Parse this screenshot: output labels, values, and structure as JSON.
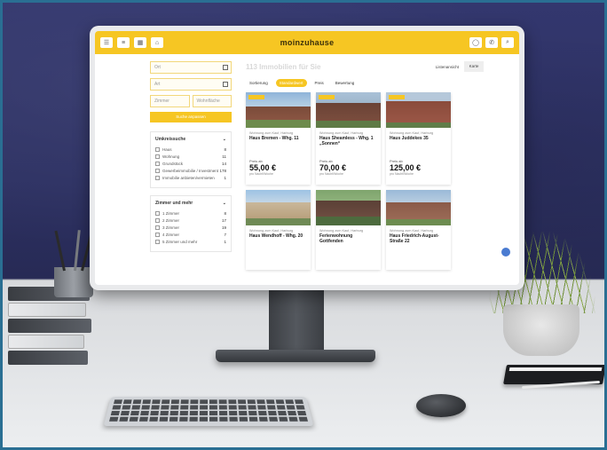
{
  "app": {
    "logo": "moinzuhause",
    "header_left_icons": [
      "menu-icon",
      "list-icon",
      "grid-icon",
      "map-icon"
    ],
    "header_right_icons": [
      "user-icon",
      "phone-icon",
      "search-icon"
    ]
  },
  "search": {
    "fields": [
      "Ort",
      "Art"
    ],
    "zimmer_label": "Zimmer",
    "wohnflaeche_label": "Wohnfläche",
    "submit": "Suche anpassen"
  },
  "filters": [
    {
      "title": "Umkreissuche",
      "options": [
        {
          "label": "Haus",
          "count": "8"
        },
        {
          "label": "Wohnung",
          "count": "11"
        },
        {
          "label": "Grundstück",
          "count": "14"
        },
        {
          "label": "Gewerbeimmobilie / Investment",
          "count": "178"
        },
        {
          "label": "Immobilie anbieten/vermieten",
          "count": "1"
        }
      ]
    },
    {
      "title": "Zimmer und mehr",
      "options": [
        {
          "label": "1 Zimmer",
          "count": "8"
        },
        {
          "label": "2 Zimmer",
          "count": "17"
        },
        {
          "label": "3 Zimmer",
          "count": "19"
        },
        {
          "label": "4 Zimmer",
          "count": "7"
        },
        {
          "label": "5 Zimmer und mehr",
          "count": "1"
        }
      ]
    }
  ],
  "main": {
    "title": "113 Immobilien für Sie",
    "list_label": "Listenansicht",
    "map_button": "Karte",
    "sort_chips": [
      "Sortierung",
      "Standardwert",
      "Preis",
      "Bewertung"
    ],
    "active_chip": 1
  },
  "listings": [
    {
      "meta": "Wohnung zum Kauf, Harburg",
      "name": "Haus Bremen - Whg. 11",
      "pre": "Preis ab",
      "price": "55,00 €",
      "sub": "pro Nacht/Woche"
    },
    {
      "meta": "Wohnung zum Kauf, Harburg",
      "name": "Haus Sheamless - Whg. 1 „Sonnen“",
      "pre": "Preis ab",
      "price": "70,00 €",
      "sub": "pro Nacht/Woche"
    },
    {
      "meta": "Wohnung zum Kauf, Harburg",
      "name": "Haus Juddekes 35",
      "pre": "Preis ab",
      "price": "125,00 €",
      "sub": "pro Nacht/Woche"
    },
    {
      "meta": "Wohnung zum Kauf, Harburg",
      "name": "Haus Wendhoff - Whg. 20",
      "pre": "",
      "price": "",
      "sub": ""
    },
    {
      "meta": "Wohnung zum Kauf, Harburg",
      "name": "Ferienwohnung Gottfenden",
      "pre": "",
      "price": "",
      "sub": ""
    },
    {
      "meta": "Wohnung zum Kauf, Harburg",
      "name": "Haus Friedrich-August-Straße 22",
      "pre": "",
      "price": "",
      "sub": ""
    }
  ],
  "colors": {
    "brand_yellow": "#f6c623",
    "wall": "#2d3163",
    "frame_border": "#2a6f93"
  }
}
